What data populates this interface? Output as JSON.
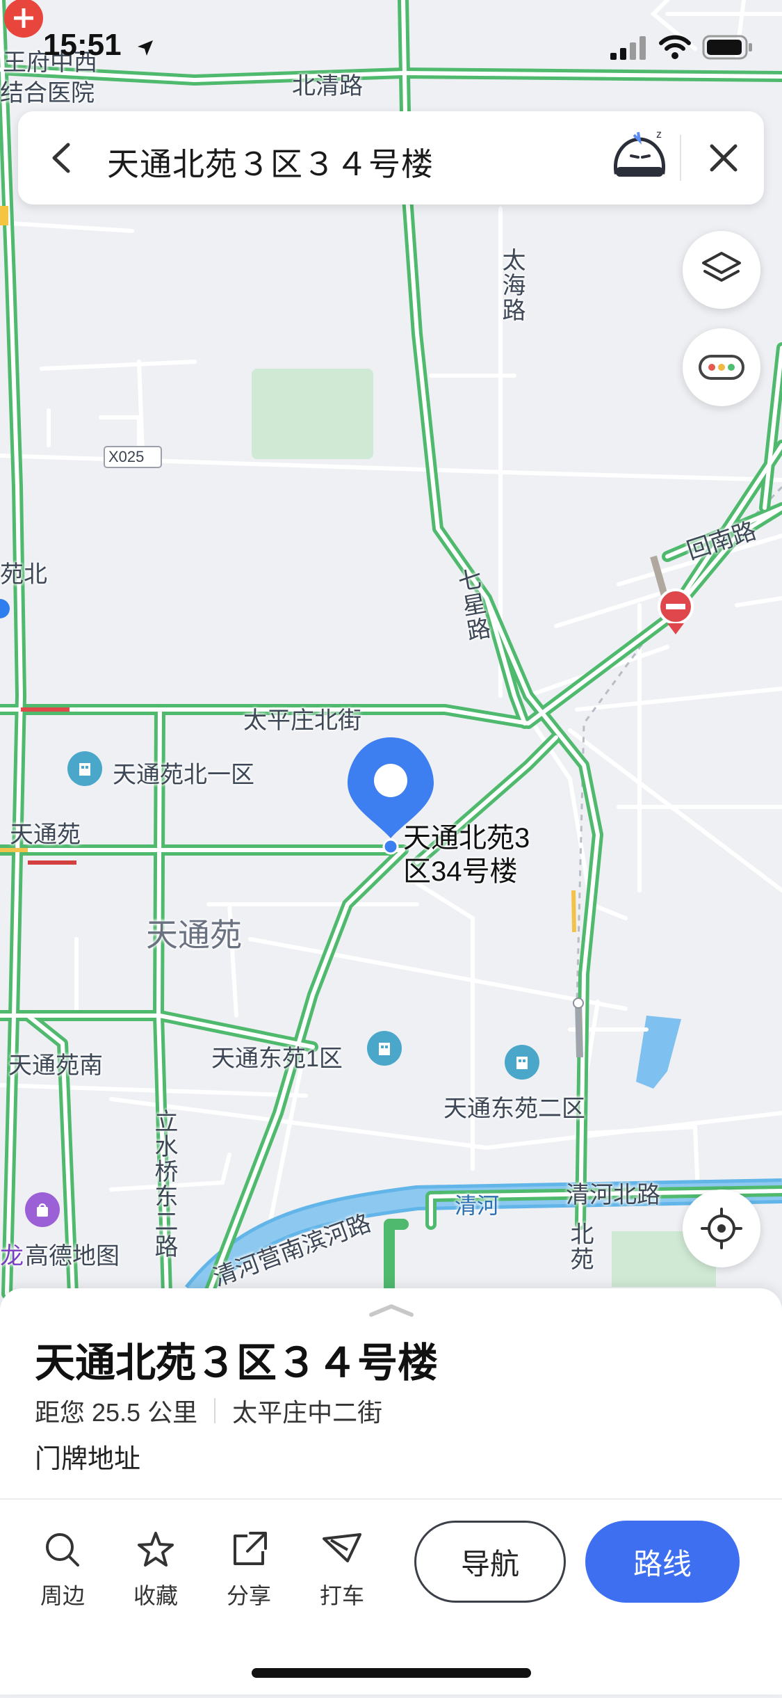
{
  "status_bar": {
    "time": "15:51"
  },
  "search": {
    "query": "天通北苑３区３４号楼"
  },
  "map": {
    "labels": {
      "wangfu": "王府中西",
      "hospital": "结合医院",
      "beiqing": "北清路",
      "taihai": "太海路",
      "x025": "X025",
      "yuanbei": "苑北",
      "huinan": "回南路",
      "qixing": "七星路",
      "taipingzhuang": "太平庄北街",
      "beiyiqu": "天通苑北一区",
      "tiantongyuan_w": "天通苑",
      "pin_label_1": "天通北苑3",
      "pin_label_2": "区34号楼",
      "tiantongyuan_c": "天通苑",
      "dongyuan1": "天通东苑1区",
      "dongyuan2": "天通东苑二区",
      "tiantongyuannan": "天通苑南",
      "lishuiqiao": "立水桥东二路",
      "qinghe_river": "清河",
      "qinghebei": "清河北路",
      "qingheying": "清河营南滨河路",
      "gaode": "高德地图",
      "long": "龙",
      "beiyuan": "北苑"
    }
  },
  "sheet": {
    "title": "天通北苑３区３４号楼",
    "distance": "距您 25.5 公里",
    "street": "太平庄中二街",
    "type": "门牌地址",
    "actions": [
      "周边",
      "收藏",
      "分享",
      "打车"
    ],
    "nav_label": "导航",
    "route_label": "路线"
  },
  "colors": {
    "road_green": "#5cc77a",
    "accent_blue": "#3d6ff0",
    "water": "#7ec0ef",
    "park": "#cfe9d4"
  }
}
